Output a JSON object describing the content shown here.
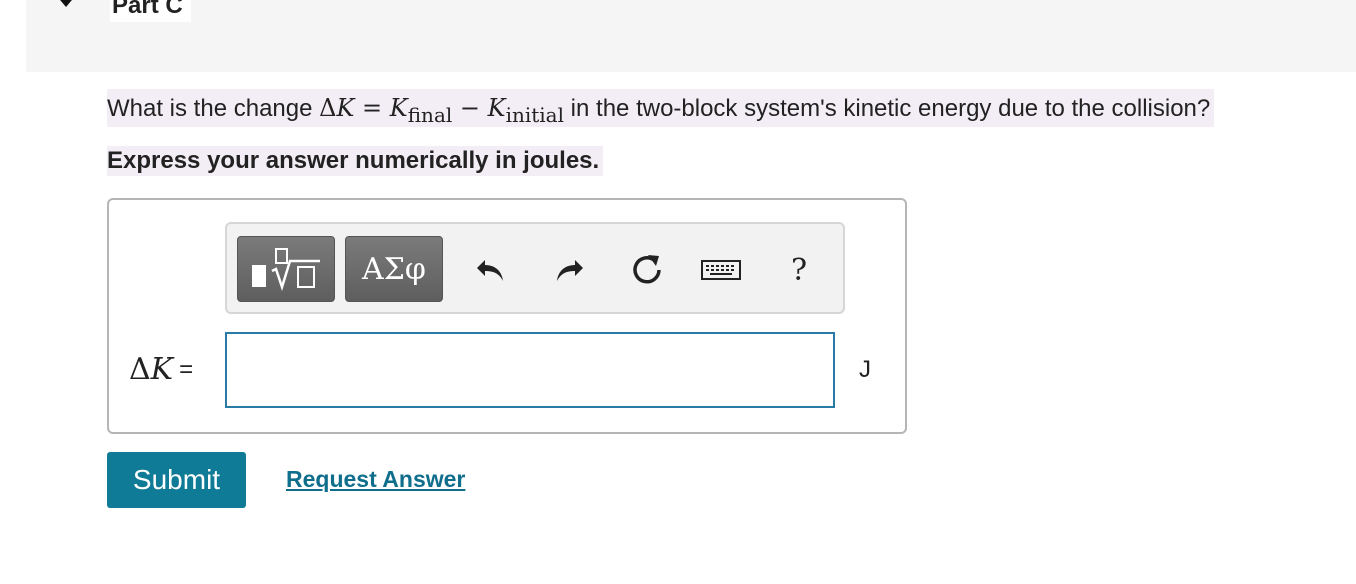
{
  "part": {
    "title": "Part C"
  },
  "question": {
    "prefix": "What is the change ",
    "delta": "Δ",
    "k": "K",
    "equals": " = ",
    "k_final": "K",
    "final_sub": "final",
    "minus": " − ",
    "k_initial": "K",
    "initial_sub": "initial",
    "suffix": " in the two-block system's kinetic energy due to the collision?"
  },
  "instruction": "Express your answer numerically in joules.",
  "toolbar": {
    "templates_icon": "templates-sqrt-icon",
    "greek_label": "ΑΣφ",
    "undo_icon": "undo-icon",
    "redo_icon": "redo-icon",
    "reset_icon": "reset-icon",
    "keyboard_icon": "keyboard-icon",
    "help_label": "?"
  },
  "answer": {
    "label_delta": "Δ",
    "label_k": "K",
    "label_eq": "=",
    "value": "",
    "unit": "J"
  },
  "actions": {
    "submit_label": "Submit",
    "request_label": "Request Answer"
  },
  "colors": {
    "accent": "#0f7b96",
    "link": "#0f6e8c",
    "highlight": "#f3eef5",
    "input_border": "#2a7aa6"
  }
}
